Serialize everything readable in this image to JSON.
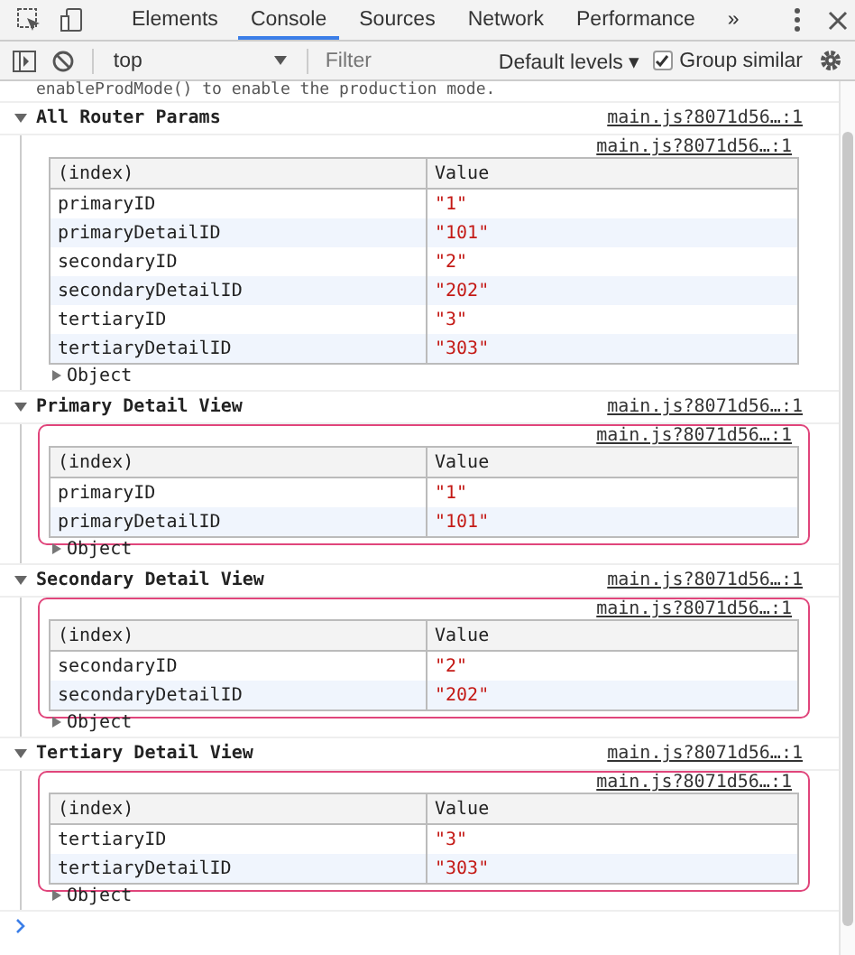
{
  "tabs": [
    {
      "label": "Elements",
      "selected": false
    },
    {
      "label": "Console",
      "selected": true
    },
    {
      "label": "Sources",
      "selected": false
    },
    {
      "label": "Network",
      "selected": false
    },
    {
      "label": "Performance",
      "selected": false
    }
  ],
  "more_tabs": "»",
  "toolbar": {
    "context": "top",
    "filter_placeholder": "Filter",
    "levels": "Default levels ▾",
    "group_similar": {
      "label": "Group similar",
      "checked": true
    }
  },
  "truncated_message": "enableProdMode() to enable the production mode.",
  "groups": [
    {
      "title": "All Router Params",
      "source": "main.js?8071d56…:1",
      "expanded": true,
      "table": {
        "source": "main.js?8071d56…:1",
        "highlighted": false,
        "columns": [
          "(index)",
          "Value"
        ],
        "rows": [
          [
            "primaryID",
            "\"1\""
          ],
          [
            "primaryDetailID",
            "\"101\""
          ],
          [
            "secondaryID",
            "\"2\""
          ],
          [
            "secondaryDetailID",
            "\"202\""
          ],
          [
            "tertiaryID",
            "\"3\""
          ],
          [
            "tertiaryDetailID",
            "\"303\""
          ]
        ]
      },
      "object": "Object"
    },
    {
      "title": "Primary Detail View",
      "source": "main.js?8071d56…:1",
      "expanded": true,
      "table": {
        "source": "main.js?8071d56…:1",
        "highlighted": true,
        "columns": [
          "(index)",
          "Value"
        ],
        "rows": [
          [
            "primaryID",
            "\"1\""
          ],
          [
            "primaryDetailID",
            "\"101\""
          ]
        ]
      },
      "object": "Object"
    },
    {
      "title": "Secondary Detail View",
      "source": "main.js?8071d56…:1",
      "expanded": true,
      "table": {
        "source": "main.js?8071d56…:1",
        "highlighted": true,
        "columns": [
          "(index)",
          "Value"
        ],
        "rows": [
          [
            "secondaryID",
            "\"2\""
          ],
          [
            "secondaryDetailID",
            "\"202\""
          ]
        ]
      },
      "object": "Object"
    },
    {
      "title": "Tertiary Detail View",
      "source": "main.js?8071d56…:1",
      "expanded": true,
      "table": {
        "source": "main.js?8071d56…:1",
        "highlighted": true,
        "columns": [
          "(index)",
          "Value"
        ],
        "rows": [
          [
            "tertiaryID",
            "\"3\""
          ],
          [
            "tertiaryDetailID",
            "\"303\""
          ]
        ]
      },
      "object": "Object"
    }
  ]
}
